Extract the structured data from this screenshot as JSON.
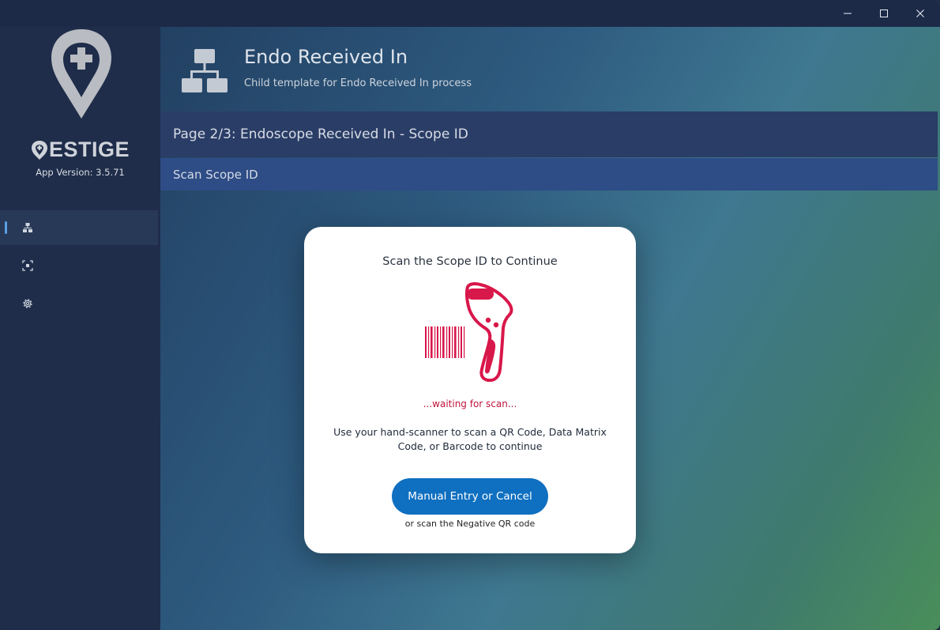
{
  "window": {
    "controls": {
      "minimize": "—",
      "maximize": "☐",
      "close": "✕"
    }
  },
  "sidebar": {
    "brand": "ESTIGE",
    "app_version": "App Version: 3.5.71",
    "nav_items": [
      {
        "icon": "workflow-icon",
        "active": true
      },
      {
        "icon": "scan-frame-icon",
        "active": false
      },
      {
        "icon": "gear-icon",
        "active": false
      }
    ]
  },
  "header": {
    "title": "Endo Received In",
    "subtitle": "Child template for Endo Received In process"
  },
  "page_bar": {
    "label": "Page 2/3: Endoscope Received In - Scope ID"
  },
  "step_bar": {
    "label": "Scan Scope ID"
  },
  "modal": {
    "title": "Scan the Scope ID to Continue",
    "status": "...waiting for scan...",
    "instructions": "Use your hand-scanner to scan a QR Code, Data Matrix Code, or Barcode to continue",
    "button_label": "Manual Entry or Cancel",
    "footnote": "or scan the Negative QR code"
  },
  "colors": {
    "accent_red": "#d8174a",
    "button_blue": "#0f6fc0",
    "sidebar_bg": "#1f2d4a"
  }
}
